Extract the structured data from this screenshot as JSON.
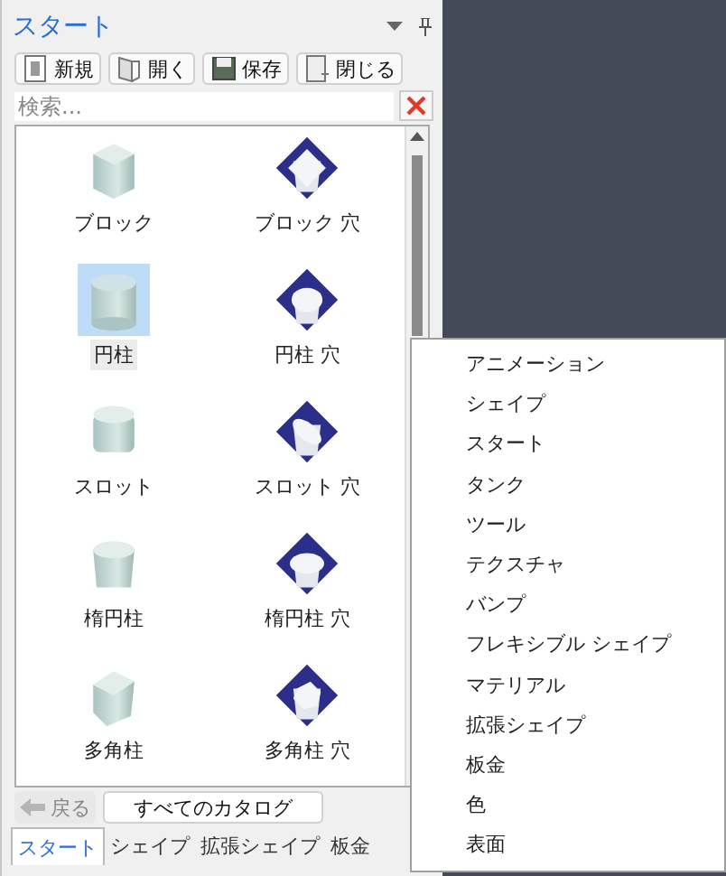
{
  "panel": {
    "title": "スタート",
    "toolbar": [
      "新規",
      "開く",
      "保存",
      "閉じる"
    ],
    "search": {
      "placeholder": "検索..."
    },
    "items": [
      {
        "label": "ブロック",
        "kind": "block",
        "selected": false
      },
      {
        "label": "ブロック 穴",
        "kind": "block-hole",
        "selected": false
      },
      {
        "label": "円柱",
        "kind": "cylinder",
        "selected": true
      },
      {
        "label": "円柱 穴",
        "kind": "cylinder-hole",
        "selected": false
      },
      {
        "label": "スロット",
        "kind": "slot",
        "selected": false
      },
      {
        "label": "スロット 穴",
        "kind": "slot-hole",
        "selected": false
      },
      {
        "label": "楕円柱",
        "kind": "ellipse",
        "selected": false
      },
      {
        "label": "楕円柱 穴",
        "kind": "ellipse-hole",
        "selected": false
      },
      {
        "label": "多角柱",
        "kind": "polygon",
        "selected": false
      },
      {
        "label": "多角柱 穴",
        "kind": "polygon-hole",
        "selected": false
      }
    ],
    "back": {
      "label": "戻る",
      "disabled": true
    },
    "catalog_button": "すべてのカタログ",
    "tabs": [
      {
        "label": "スタート",
        "selected": true
      },
      {
        "label": "シェイプ",
        "selected": false
      },
      {
        "label": "拡張シェイプ",
        "selected": false
      },
      {
        "label": "板金",
        "selected": false
      }
    ]
  },
  "menu": [
    "アニメーション",
    "シェイプ",
    "スタート",
    "タンク",
    "ツール",
    "テクスチャ",
    "バンプ",
    "フレキシブル シェイプ",
    "マテリアル",
    "拡張シェイプ",
    "板金",
    "色",
    "表面"
  ]
}
